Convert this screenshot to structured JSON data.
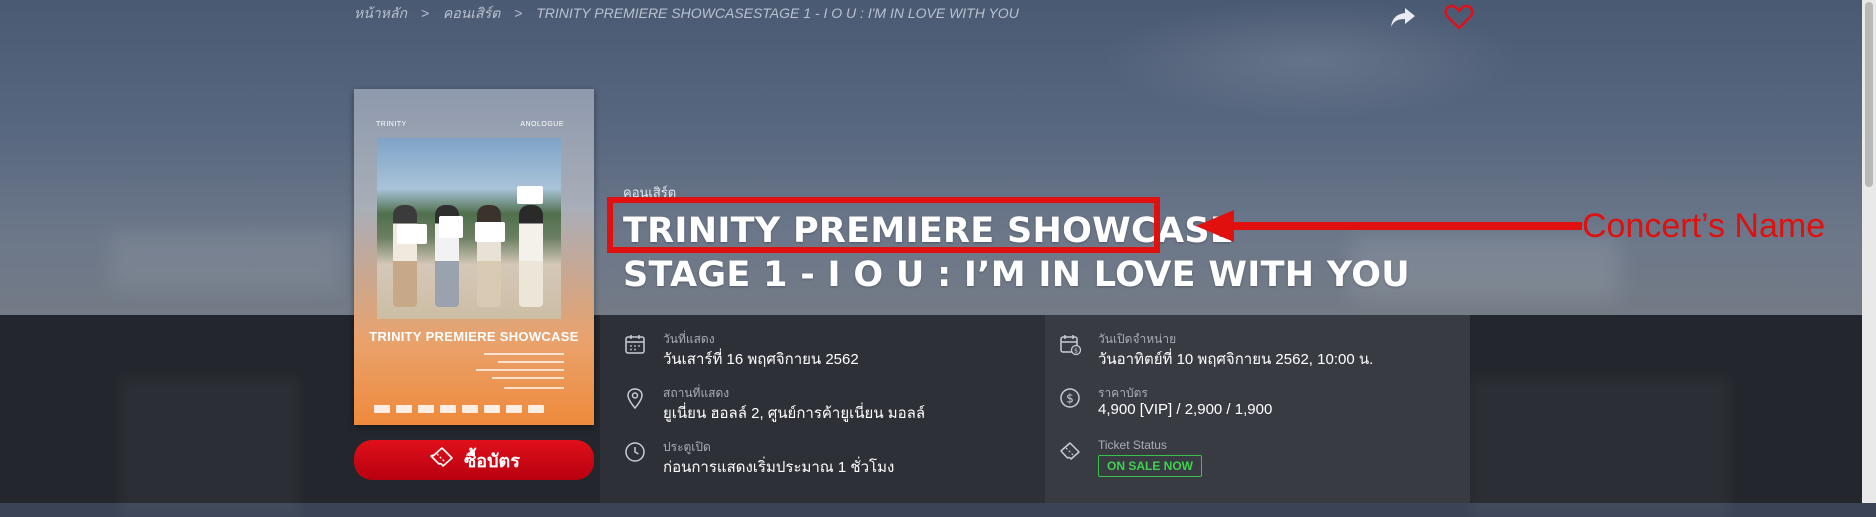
{
  "breadcrumb": {
    "home": "หน้าหลัก",
    "sep": ">",
    "category": "คอนเสิร์ต",
    "current": "TRINITY PREMIERE SHOWCASESTAGE 1 - I O U : I'M IN LOVE WITH YOU"
  },
  "header_icons": [
    "share-icon",
    "heart-icon"
  ],
  "poster": {
    "top_left": "TRINITY",
    "top_right": "ANOLOGUE",
    "name": "TRINITY PREMIERE SHOWCASE"
  },
  "buy_button": {
    "label": "ซื้อบัตร",
    "icon": "ticket-icon"
  },
  "event": {
    "category": "คอนเสิร์ต",
    "title_line1": "TRINITY PREMIERE SHOWCASE",
    "title_line2": "STAGE 1 - I O U : I’M IN LOVE WITH YOU"
  },
  "annotation": {
    "label": "Concert’s Name",
    "color": "#e0100e"
  },
  "info": {
    "show_date": {
      "label": "วันที่แสดง",
      "value": "วันเสาร์ที่ 16 พฤศจิกายน 2562",
      "icon": "calendar-icon"
    },
    "venue": {
      "label": "สถานที่แสดง",
      "value": "ยูเนี่ยน ฮอลล์ 2, ศูนย์การค้ายูเนี่ยน มอลล์",
      "icon": "location-pin-icon"
    },
    "doors": {
      "label": "ประตูเปิด",
      "value": "ก่อนการแสดงเริ่มประมาณ 1 ชั่วโมง",
      "icon": "clock-icon"
    },
    "sale_date": {
      "label": "วันเปิดจำหน่าย",
      "value": "วันอาทิตย์ที่ 10 พฤศจิกายน 2562, 10:00 น.",
      "icon": "calendar-money-icon"
    },
    "price": {
      "label": "ราคาบัตร",
      "value": "4,900 [VIP] / 2,900 / 1,900",
      "icon": "dollar-icon"
    },
    "ticket_status": {
      "label": "Ticket Status",
      "value": "ON SALE NOW",
      "icon": "ticket-icon",
      "color": "#3fd24f"
    }
  },
  "colors": {
    "accent": "#e0100e",
    "buy_button": "#d40a16",
    "status_green": "#3fd24f"
  }
}
